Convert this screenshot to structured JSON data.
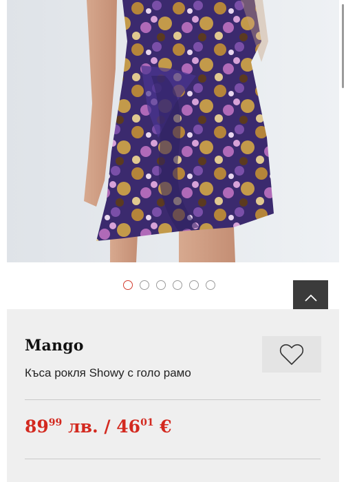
{
  "carousel": {
    "image_alt": "Mango Къса рокля Showy с голо рамо",
    "slide_count": 6,
    "active_index": 0
  },
  "back_to_top": {
    "icon": "chevron-up-icon"
  },
  "product": {
    "brand": "Mango",
    "name": "Къса рокля Showy с голо рамо",
    "wishlist_icon": "heart-icon",
    "price": {
      "bgn_main": "89",
      "bgn_cents": "99",
      "bgn_currency": "лв.",
      "separator": "/",
      "eur_main": "46",
      "eur_cents": "01",
      "eur_currency": "€"
    }
  },
  "colors": {
    "price": "#d3291f",
    "active_dot": "#d23a2c",
    "panel_bg": "#efefef",
    "back_to_top_bg": "#3b3b3b"
  }
}
